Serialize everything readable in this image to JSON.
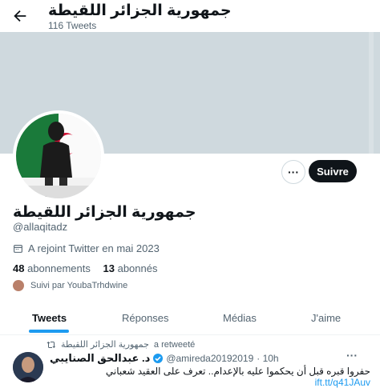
{
  "header": {
    "title": "جمهورية الجزائر اللقيطة",
    "tweet_count": "116 Tweets"
  },
  "profile": {
    "name": "جمهورية الجزائر اللقيطة",
    "handle": "@allaqitadz",
    "joined": "A rejoint Twitter en mai 2023",
    "following_count": "48",
    "following_label": "abonnements",
    "followers_count": "13",
    "followers_label": "abonnés",
    "followed_by": "Suivi par YoubaTrhdwine"
  },
  "buttons": {
    "more": "···",
    "follow": "Suivre"
  },
  "tabs": [
    {
      "label": "Tweets",
      "active": true
    },
    {
      "label": "Réponses",
      "active": false
    },
    {
      "label": "Médias",
      "active": false
    },
    {
      "label": "J'aime",
      "active": false
    }
  ],
  "tweet": {
    "retweet_by": "جمهورية الجزائر اللقيطة",
    "retweet_label": "a retweeté",
    "author_name": "د. عبدالحق الصنايبي",
    "author_handle": "@amireda20192019",
    "time": "· 10h",
    "more": "···",
    "text": "حفروا قبره قبل أن يحكموا عليه بالإعدام.. تعرف على العقيد شعباني",
    "link": "ift.tt/q41JAuv"
  },
  "colors": {
    "accent": "#1d9bf0",
    "banner": "#cfd9de",
    "follow_bg": "#0f1419"
  },
  "icons": {
    "back": "arrow-left-icon",
    "calendar": "calendar-icon",
    "retweet": "retweet-icon",
    "verified": "verified-badge-icon"
  }
}
